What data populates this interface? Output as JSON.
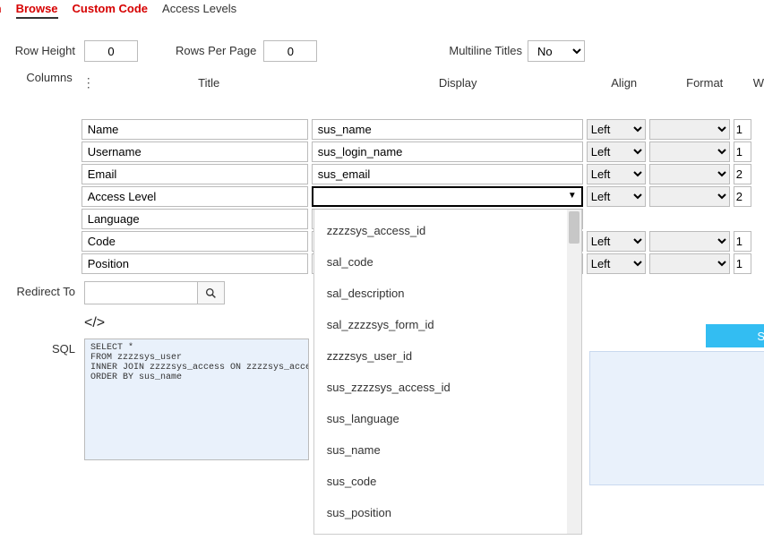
{
  "tabs": {
    "t0": "in",
    "t1": "Browse",
    "t2": "Custom Code",
    "t3": "Access Levels"
  },
  "form": {
    "row_height_label": "Row Height",
    "row_height_value": "0",
    "rows_per_page_label": "Rows Per Page",
    "rows_per_page_value": "0",
    "multiline_label": "Multiline Titles",
    "multiline_value": "No",
    "columns_label": "Columns",
    "redirect_label": "Redirect To",
    "redirect_value": "",
    "sql_label": "SQL",
    "save_label": "S"
  },
  "headers": {
    "title": "Title",
    "display": "Display",
    "align": "Align",
    "format": "Format",
    "w": "W"
  },
  "align_opt": "Left",
  "rows": [
    {
      "title": "Name",
      "display": "sus_name",
      "align": "Left",
      "format": "",
      "w": "1"
    },
    {
      "title": "Username",
      "display": "sus_login_name",
      "align": "Left",
      "format": "",
      "w": "1"
    },
    {
      "title": "Email",
      "display": "sus_email",
      "align": "Left",
      "format": "",
      "w": "2"
    },
    {
      "title": "Access Level",
      "display": "",
      "align": "Left",
      "format": "",
      "w": "2",
      "combo_open": true
    },
    {
      "title": "Language",
      "display": "",
      "align": "",
      "format": "",
      "w": ""
    },
    {
      "title": "Code",
      "display": "",
      "align": "Left",
      "format": "",
      "w": "1"
    },
    {
      "title": "Position",
      "display": "",
      "align": "Left",
      "format": "",
      "w": "1"
    }
  ],
  "dropdown_options": [
    "zzzzsys_access_id",
    "sal_code",
    "sal_description",
    "sal_zzzzsys_form_id",
    "zzzzsys_user_id",
    "sus_zzzzsys_access_id",
    "sus_language",
    "sus_name",
    "sus_code",
    "sus_position"
  ],
  "sql_text": "SELECT *\nFROM zzzzsys_user\nINNER JOIN zzzzsys_access ON zzzzsys_access\nORDER BY sus_name"
}
